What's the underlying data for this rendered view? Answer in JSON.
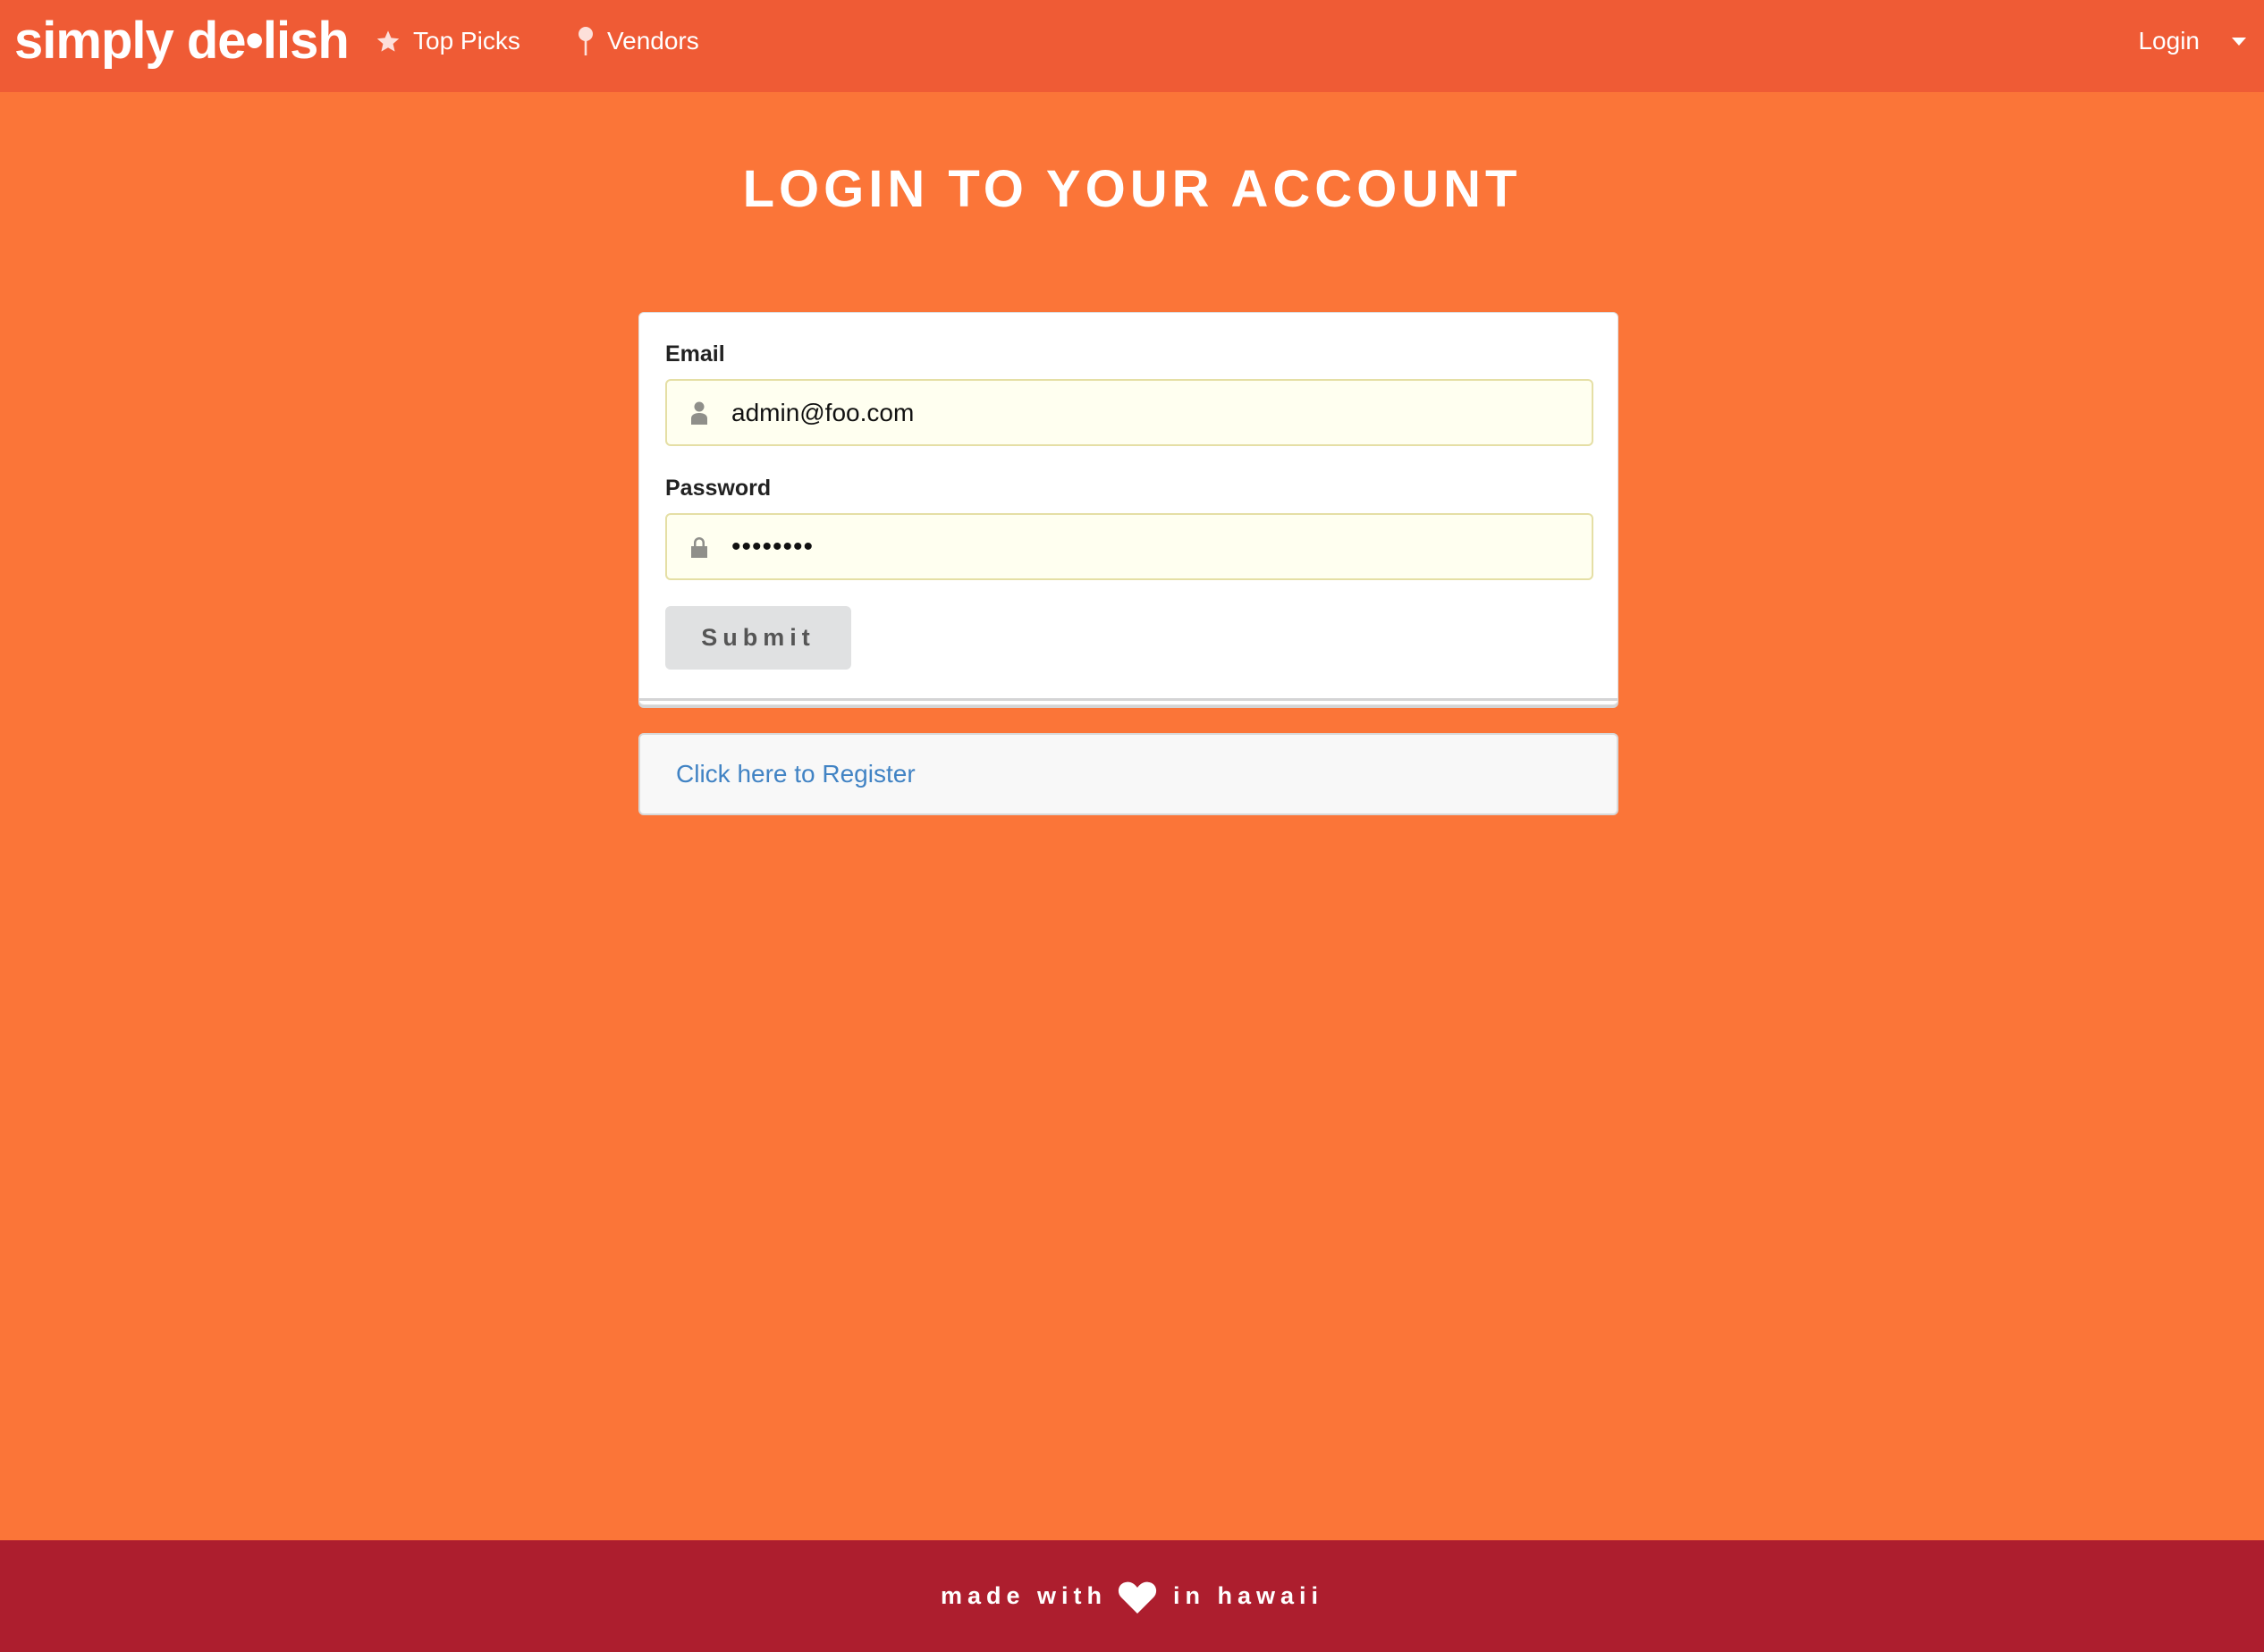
{
  "nav": {
    "logo": "simply de•lish",
    "items": [
      {
        "label": "Top Picks",
        "icon": "star-icon"
      },
      {
        "label": "Vendors",
        "icon": "map-pin-icon"
      }
    ],
    "login": "Login"
  },
  "page": {
    "title": "LOGIN TO YOUR ACCOUNT"
  },
  "form": {
    "email_label": "Email",
    "email_value": "admin@foo.com",
    "password_label": "Password",
    "password_value": "••••••••",
    "submit": "Submit"
  },
  "register": {
    "link": "Click here to Register"
  },
  "footer": {
    "before": "made with",
    "after": "in hawaii",
    "icon": "heart-icon"
  },
  "colors": {
    "navbar": "#EF5B35",
    "background": "#FB7538",
    "footer": "#AD1E2E",
    "link": "#4183C4",
    "input_bg": "#FFFFF0"
  }
}
